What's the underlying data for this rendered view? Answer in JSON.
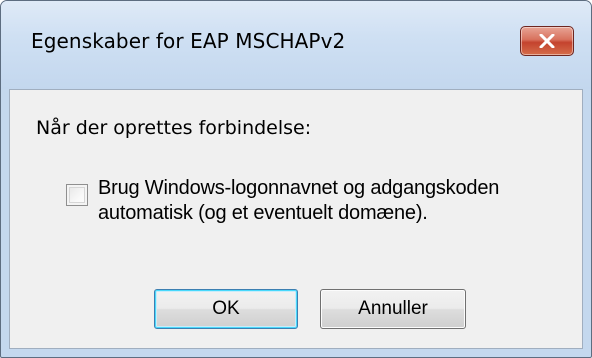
{
  "dialog": {
    "title": "Egenskaber for EAP MSCHAPv2",
    "prompt": "Når der oprettes forbindelse:",
    "checkbox": {
      "label": "Brug Windows-logonnavnet og adgangskoden automatisk (og et eventuelt domæne).",
      "checked": false
    },
    "buttons": {
      "ok_label": "OK",
      "cancel_label": "Annuller"
    },
    "close_icon": "close-x-icon"
  },
  "colors": {
    "frame": "#c4d8ee",
    "client": "#f0f0f0",
    "close_button": "#c4432e",
    "default_button_border": "#3c7fb1"
  }
}
